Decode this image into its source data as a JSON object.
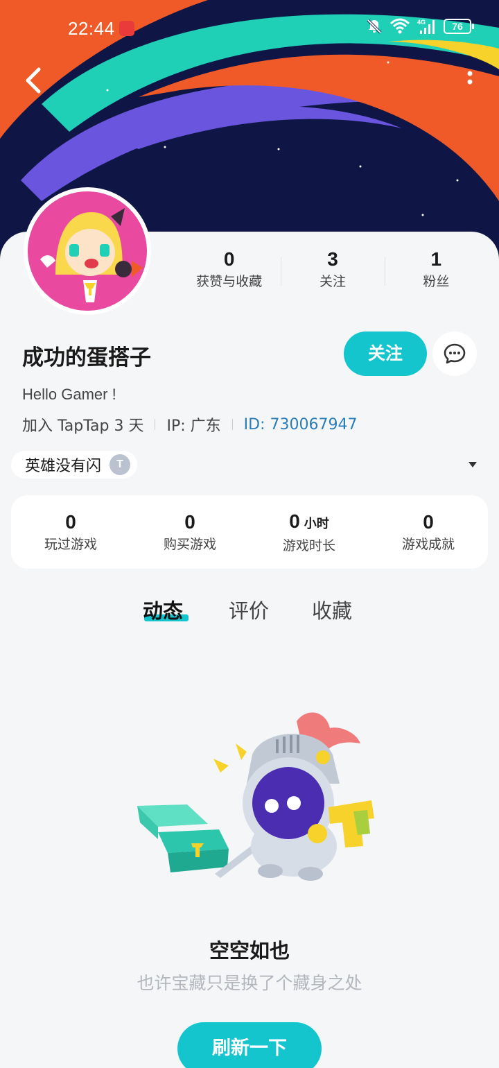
{
  "status_bar": {
    "time": "22:44",
    "battery": "76",
    "network": "4G"
  },
  "profile": {
    "username": "成功的蛋搭子",
    "bio": "Hello Gamer !",
    "join_info": "加入 TapTap 3 天",
    "ip": "IP:  广东",
    "id": "ID:  730067947",
    "follow_label": "关注",
    "stats": [
      {
        "value": "0",
        "label": "获赞与收藏"
      },
      {
        "value": "3",
        "label": "关注"
      },
      {
        "value": "1",
        "label": "粉丝"
      }
    ]
  },
  "tag": {
    "label": "英雄没有闪",
    "badge": "T"
  },
  "game_stats": [
    {
      "value": "0",
      "unit": "",
      "label": "玩过游戏"
    },
    {
      "value": "0",
      "unit": "",
      "label": "购买游戏"
    },
    {
      "value": "0",
      "unit": "小时",
      "label": "游戏时长"
    },
    {
      "value": "0",
      "unit": "",
      "label": "游戏成就"
    }
  ],
  "tabs": [
    {
      "label": "动态",
      "active": true
    },
    {
      "label": "评价",
      "active": false
    },
    {
      "label": "收藏",
      "active": false
    }
  ],
  "empty_state": {
    "title": "空空如也",
    "subtitle": "也许宝藏只是换了个藏身之处",
    "button": "刷新一下"
  },
  "colors": {
    "accent": "#15c5ce",
    "banner_bg": "#0f1545",
    "id_link": "#2a7db8"
  },
  "icons": [
    "back-arrow-icon",
    "more-vertical-icon",
    "chat-bubble-icon",
    "bell-muted-icon",
    "wifi-icon",
    "signal-icon",
    "battery-icon",
    "chevron-down-icon"
  ]
}
